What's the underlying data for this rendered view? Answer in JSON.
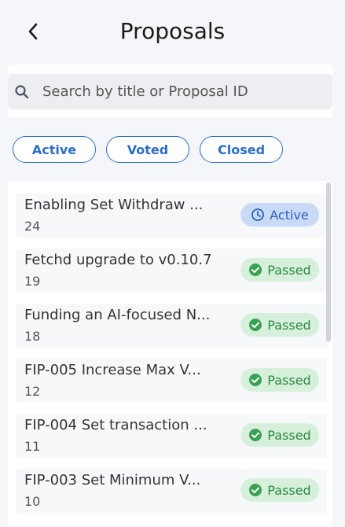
{
  "header": {
    "title": "Proposals"
  },
  "search": {
    "placeholder": "Search by title or Proposal ID"
  },
  "filters": [
    {
      "label": "Active"
    },
    {
      "label": "Voted"
    },
    {
      "label": "Closed"
    }
  ],
  "proposals": [
    {
      "title": "Enabling Set Withdraw ...",
      "id": "24",
      "status": "Active",
      "status_type": "active"
    },
    {
      "title": "Fetchd upgrade to v0.10.7",
      "id": "19",
      "status": "Passed",
      "status_type": "passed"
    },
    {
      "title": "Funding an AI-focused N...",
      "id": "18",
      "status": "Passed",
      "status_type": "passed"
    },
    {
      "title": "FIP-005 Increase Max V...",
      "id": "12",
      "status": "Passed",
      "status_type": "passed"
    },
    {
      "title": "FIP-004 Set transaction ...",
      "id": "11",
      "status": "Passed",
      "status_type": "passed"
    },
    {
      "title": "FIP-003 Set Minimum V...",
      "id": "10",
      "status": "Passed",
      "status_type": "passed"
    }
  ],
  "colors": {
    "accent": "#2c6ec6",
    "active_badge_bg": "#c9daf6",
    "passed_badge_bg": "#d7f0dc",
    "passed_text": "#2a8a3e"
  },
  "icons": {
    "back": "chevron-left-icon",
    "search": "search-icon",
    "active": "clock-icon",
    "passed": "check-circle-icon"
  }
}
